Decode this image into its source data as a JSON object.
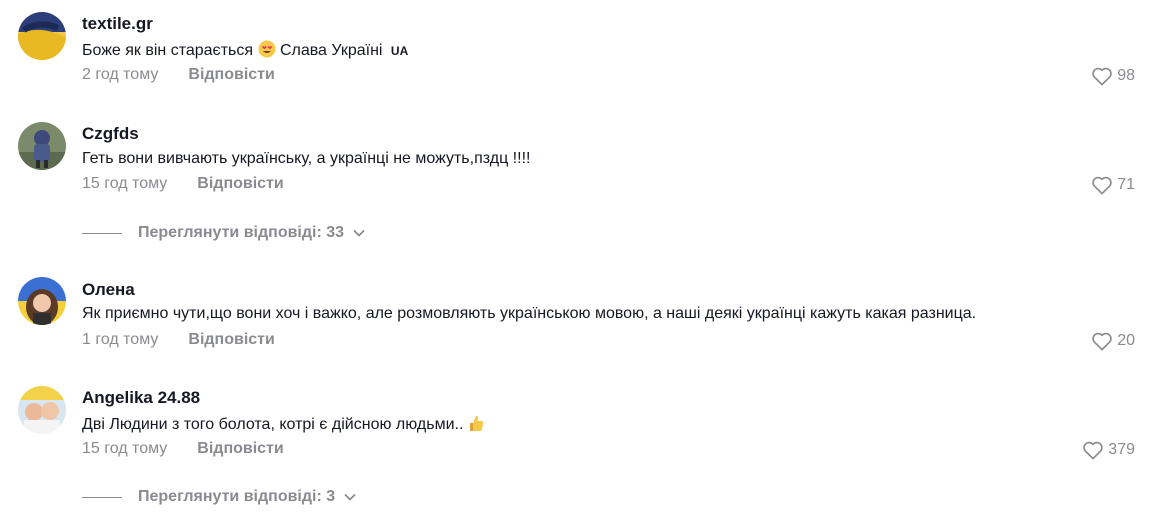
{
  "comments": [
    {
      "username": "textile.gr",
      "text_before": "Боже як він старається ",
      "emoji": "smiling-face-with-heart-eyes",
      "text_after": " Слава Україні ",
      "flag_text": "UA",
      "time": "2 год тому",
      "reply_label": "Відповісти",
      "likes": "98"
    },
    {
      "username": "Czgfds",
      "text": "Геть вони вивчають українську, а українці не можуть,пздц !!!!",
      "time": "15 год тому",
      "reply_label": "Відповісти",
      "likes": "71",
      "view_replies": "Переглянути відповіді: 33"
    },
    {
      "username": "Олена",
      "text": "Як приємно чути,що вони хоч і важко, але розмовляють українською мовою, а наші деякі українці кажуть какая разница.",
      "time": "1 год тому",
      "reply_label": "Відповісти",
      "likes": "20"
    },
    {
      "username": "Angelika 24.88",
      "text": "Дві Людини з того болота, котрі є дійсною людьми.. ",
      "emoji": "thumbs-up",
      "time": "15 год тому",
      "reply_label": "Відповісти",
      "likes": "379",
      "view_replies": "Переглянути відповіді: 3"
    }
  ],
  "icons": {
    "like": "heart-outline-icon",
    "expand": "chevron-down-icon"
  },
  "colors": {
    "text": "#161823",
    "secondary": "#8a8b91",
    "flag_blue": "#1f5fbf",
    "flag_yellow": "#f5c518"
  }
}
